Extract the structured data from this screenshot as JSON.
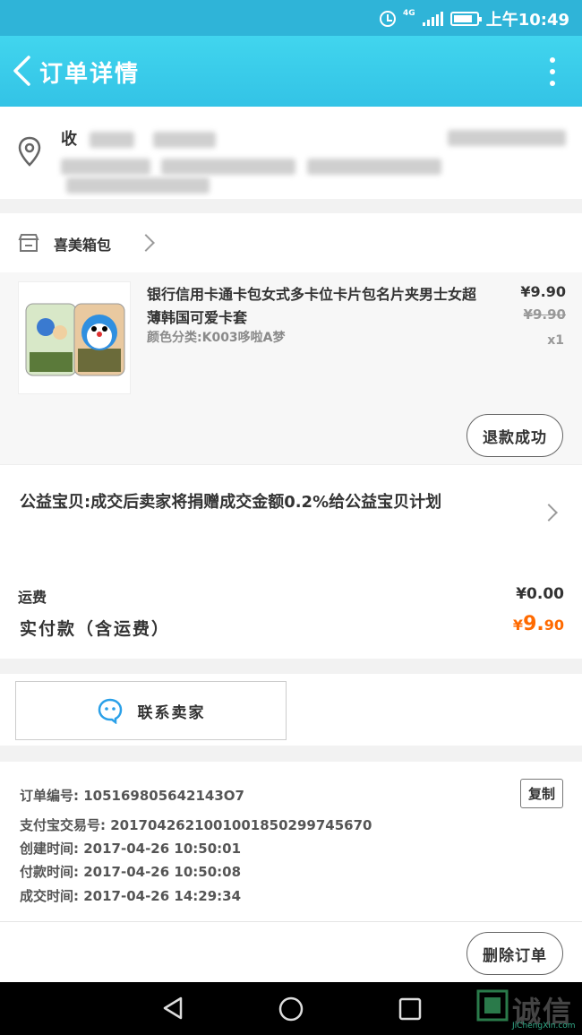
{
  "status_bar": {
    "network": "4G",
    "time": "上午10:49"
  },
  "navbar": {
    "title": "订单详情"
  },
  "address": {
    "line1_prefix": "收",
    "line2_prefix": ""
  },
  "shop": {
    "name": "喜美箱包"
  },
  "item": {
    "title": "银行信用卡通卡包女式多卡位卡片包名片夹男士女超薄韩国可爱卡套",
    "sku": "颜色分类:K003哆啦A梦",
    "price": "¥9.90",
    "original_price": "¥9.90",
    "quantity": "x1",
    "status_button": "退款成功"
  },
  "charity": {
    "text": "公益宝贝:成交后卖家将捐赠成交金额0.2%给公益宝贝计划"
  },
  "cost": {
    "shipping_label": "运费",
    "shipping_value": "¥0.00",
    "paid_label": "实付款（含运费）",
    "paid_currency": "¥",
    "paid_int": "9.",
    "paid_dec": "90"
  },
  "contact": {
    "label": "联系卖家"
  },
  "order_info": {
    "order_no": "订单编号: 105169805642143O7",
    "alipay_no": "支付宝交易号: 2017042621001001850299745670",
    "created": "创建时间: 2017-04-26 10:50:01",
    "paid": "付款时间: 2017-04-26 10:50:08",
    "completed": "成交时间: 2017-04-26 14:29:34",
    "copy_label": "复制",
    "delete_label": "删除订单"
  },
  "watermark": {
    "text": "诚信",
    "sub": "JiChengXin.com"
  },
  "colors": {
    "header": "#3cc8ea",
    "accent_price": "#ff6a00"
  }
}
